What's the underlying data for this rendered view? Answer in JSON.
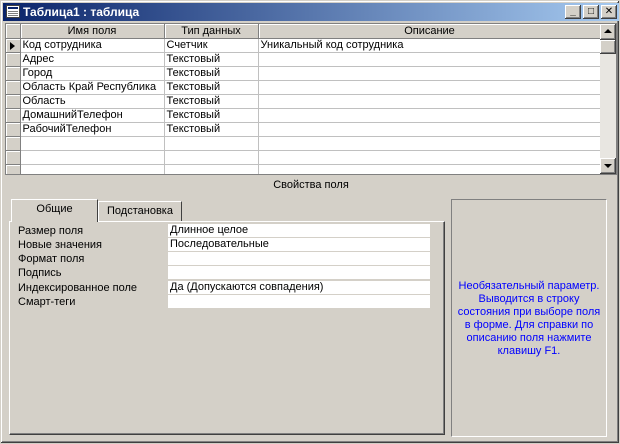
{
  "window": {
    "title": "Таблица1 : таблица",
    "buttons": {
      "minimize": "_",
      "maximize": "□",
      "close": "✕"
    }
  },
  "grid": {
    "columns": [
      "Имя поля",
      "Тип данных",
      "Описание"
    ],
    "rows": [
      {
        "name": "Код сотрудника",
        "type": "Счетчик",
        "description": "Уникальный код сотрудника",
        "selected": true
      },
      {
        "name": "Адрес",
        "type": "Текстовый",
        "description": ""
      },
      {
        "name": "Город",
        "type": "Текстовый",
        "description": ""
      },
      {
        "name": "Область Край Республика",
        "type": "Текстовый",
        "description": ""
      },
      {
        "name": "Область",
        "type": "Текстовый",
        "description": ""
      },
      {
        "name": "ДомашнийТелефон",
        "type": "Текстовый",
        "description": ""
      },
      {
        "name": "РабочийТелефон",
        "type": "Текстовый",
        "description": ""
      },
      {
        "name": "",
        "type": "",
        "description": ""
      },
      {
        "name": "",
        "type": "",
        "description": ""
      },
      {
        "name": "",
        "type": "",
        "description": ""
      }
    ]
  },
  "properties": {
    "header": "Свойства поля",
    "tabs": [
      {
        "label": "Общие",
        "active": true
      },
      {
        "label": "Подстановка",
        "active": false
      }
    ],
    "fields": [
      {
        "label": "Размер поля",
        "value": "Длинное целое"
      },
      {
        "label": "Новые значения",
        "value": "Последовательные"
      },
      {
        "label": "Формат поля",
        "value": ""
      },
      {
        "label": "Подпись",
        "value": ""
      },
      {
        "label": "Индексированное поле",
        "value": "Да (Допускаются совпадения)"
      },
      {
        "label": "Смарт-теги",
        "value": ""
      }
    ],
    "hint": "Необязательный параметр. Выводится в строку состояния при выборе поля в форме. Для справки по описанию поля нажмите клавишу F1."
  },
  "colors": {
    "title_gradient_start": "#0a246a",
    "title_gradient_end": "#a6caf0",
    "hint_text": "#0000ff",
    "chrome": "#d4d0c8"
  }
}
